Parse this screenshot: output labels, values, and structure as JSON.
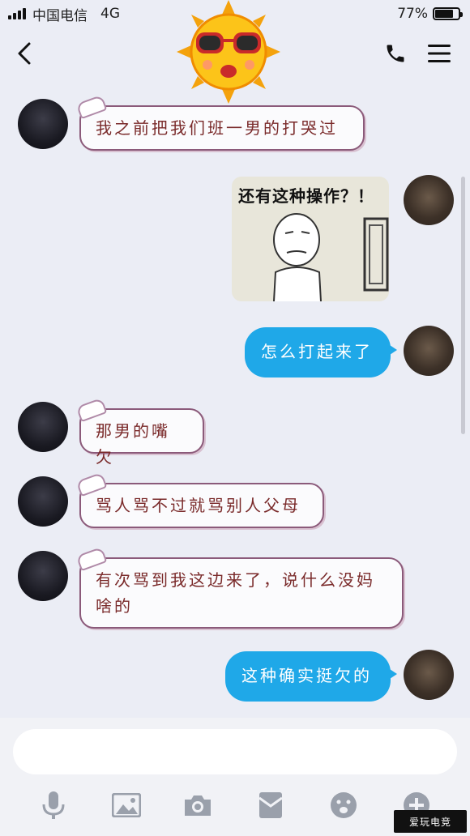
{
  "status_bar": {
    "carrier": "中国电信",
    "network": "4G",
    "battery": "77%",
    "battery_level": 0.77
  },
  "nav": {
    "back_icon": "chevron-left-icon",
    "call_icon": "phone-icon",
    "menu_icon": "hamburger-menu-icon"
  },
  "messages": [
    {
      "side": "in",
      "type": "text",
      "text": "我之前把我们班一男的打哭过"
    },
    {
      "side": "out",
      "type": "image",
      "caption": "还有这种操作？！"
    },
    {
      "side": "out",
      "type": "text",
      "text": "怎么打起来了"
    },
    {
      "side": "in",
      "type": "text",
      "text": "那男的嘴欠"
    },
    {
      "side": "in",
      "type": "text",
      "text": "骂人骂不过就骂别人父母"
    },
    {
      "side": "in",
      "type": "text",
      "text": "有次骂到我这边来了，说什么没妈啥的"
    },
    {
      "side": "out",
      "type": "text",
      "text": "这种确实挺欠的"
    }
  ],
  "input": {
    "value": "",
    "placeholder": ""
  },
  "toolbar": {
    "icons": [
      "microphone-icon",
      "image-icon",
      "camera-icon",
      "red-packet-icon",
      "emoji-icon",
      "plus-icon"
    ]
  },
  "watermark": "爱玩电竞",
  "colors": {
    "outgoing_bubble": "#1fa8e8",
    "incoming_text": "#7a2a2a",
    "background": "#ebedf5"
  }
}
